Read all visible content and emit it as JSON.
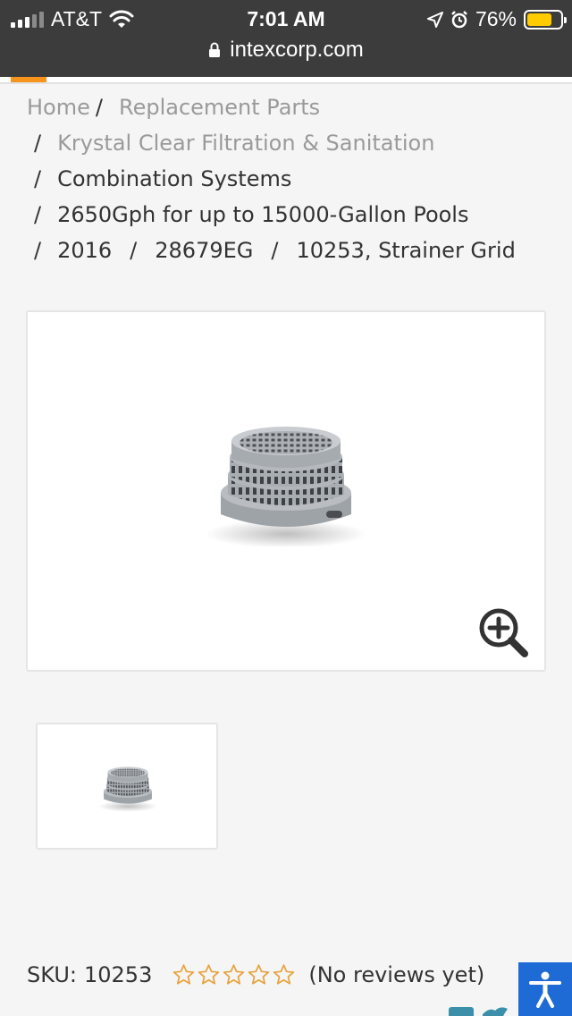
{
  "status_bar": {
    "carrier": "AT&T",
    "time": "7:01 AM",
    "battery_percent": "76%",
    "battery_level": 0.76
  },
  "browser": {
    "url": "intexcorp.com",
    "load_progress": 0.08
  },
  "breadcrumb": {
    "home": "Home",
    "separator": "/",
    "replacement_parts": "Replacement Parts",
    "krystal_clear": "Krystal Clear Filtration & Sanitation",
    "combination_systems": "Combination Systems",
    "pump_model": "2650Gph for up to 15000-Gallon Pools",
    "year": "2016",
    "model_number": "28679EG",
    "current_part": "10253, Strainer Grid"
  },
  "product": {
    "image_icon": "strainer-grid-image",
    "zoom_icon": "zoom-in-icon",
    "sku_label": "SKU:",
    "sku_value": "10253",
    "rating_stars": 0,
    "reviews_text": "(No reviews yet)"
  },
  "colors": {
    "accent": "#f7941d",
    "star_outline": "#e8a33d",
    "accessibility": "#1f6bd6",
    "header_bg": "#3c3c3c"
  }
}
